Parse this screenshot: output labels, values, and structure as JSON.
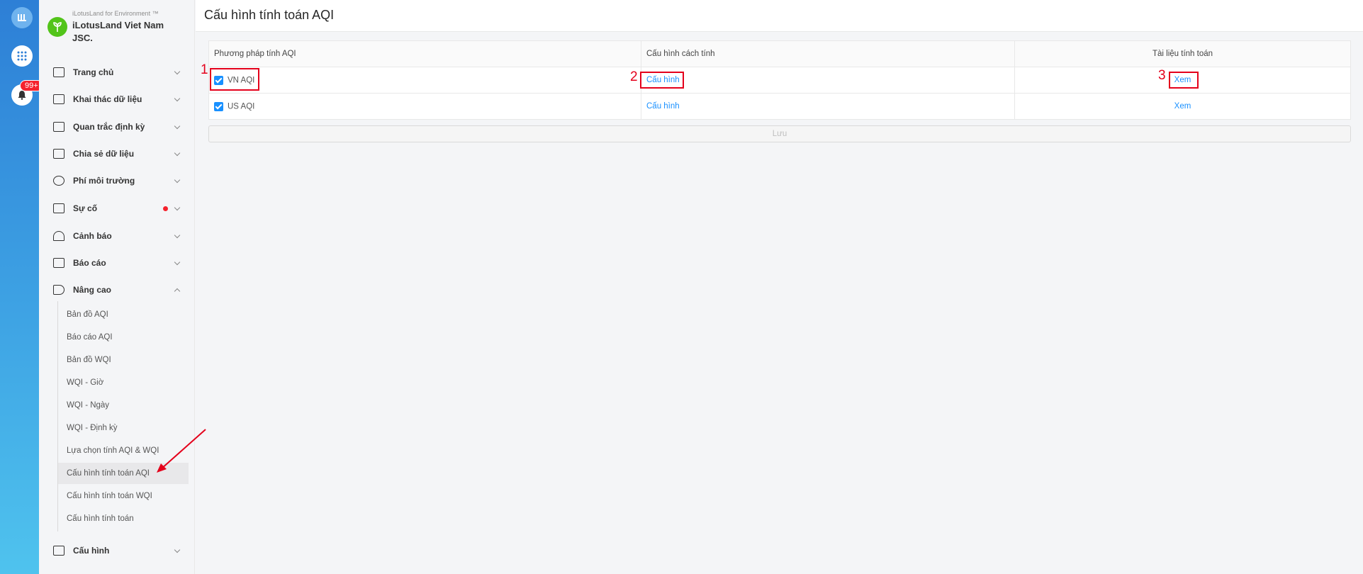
{
  "rail": {
    "notification_count": "99+"
  },
  "brand": {
    "tagline": "iLotusLand for Environment ™",
    "name": "iLotusLand Viet Nam JSC."
  },
  "sidebar": {
    "items": [
      {
        "label": "Trang chủ",
        "icon": "home-icon"
      },
      {
        "label": "Khai thác dữ liệu",
        "icon": "data-mining-icon"
      },
      {
        "label": "Quan trắc định kỳ",
        "icon": "periodic-monitoring-icon"
      },
      {
        "label": "Chia sẻ dữ liệu",
        "icon": "share-data-icon"
      },
      {
        "label": "Phí môi trường",
        "icon": "dollar-icon"
      },
      {
        "label": "Sự cố",
        "icon": "incident-icon"
      },
      {
        "label": "Cảnh báo",
        "icon": "alarm-icon"
      },
      {
        "label": "Báo cáo",
        "icon": "report-icon"
      },
      {
        "label": "Nâng cao",
        "icon": "megaphone-icon"
      },
      {
        "label": "Cấu hình",
        "icon": "config-icon"
      }
    ],
    "advanced_sub": [
      "Bản đồ AQI",
      "Báo cáo AQI",
      "Bản đồ WQI",
      "WQI - Giờ",
      "WQI - Ngày",
      "WQI - Định kỳ",
      "Lựa chọn tính AQI & WQI",
      "Cấu hình tính toán AQI",
      "Cấu hình tính toán WQI",
      "Cấu hình tính toán"
    ]
  },
  "page": {
    "title": "Cấu hình tính toán AQI"
  },
  "table": {
    "headers": [
      "Phương pháp tính AQI",
      "Cấu hình cách tính",
      "Tài liệu tính toán"
    ],
    "rows": [
      {
        "method": "VN AQI",
        "config": "Cấu hình",
        "doc": "Xem"
      },
      {
        "method": "US AQI",
        "config": "Cấu hình",
        "doc": "Xem"
      }
    ]
  },
  "save_label": "Lưu",
  "annotations": [
    "1",
    "2",
    "3"
  ],
  "colors": {
    "accent": "#1890ff",
    "annotation": "#e4001b",
    "rail_top": "#2d7fd6",
    "rail_bottom": "#4fc3ee"
  }
}
